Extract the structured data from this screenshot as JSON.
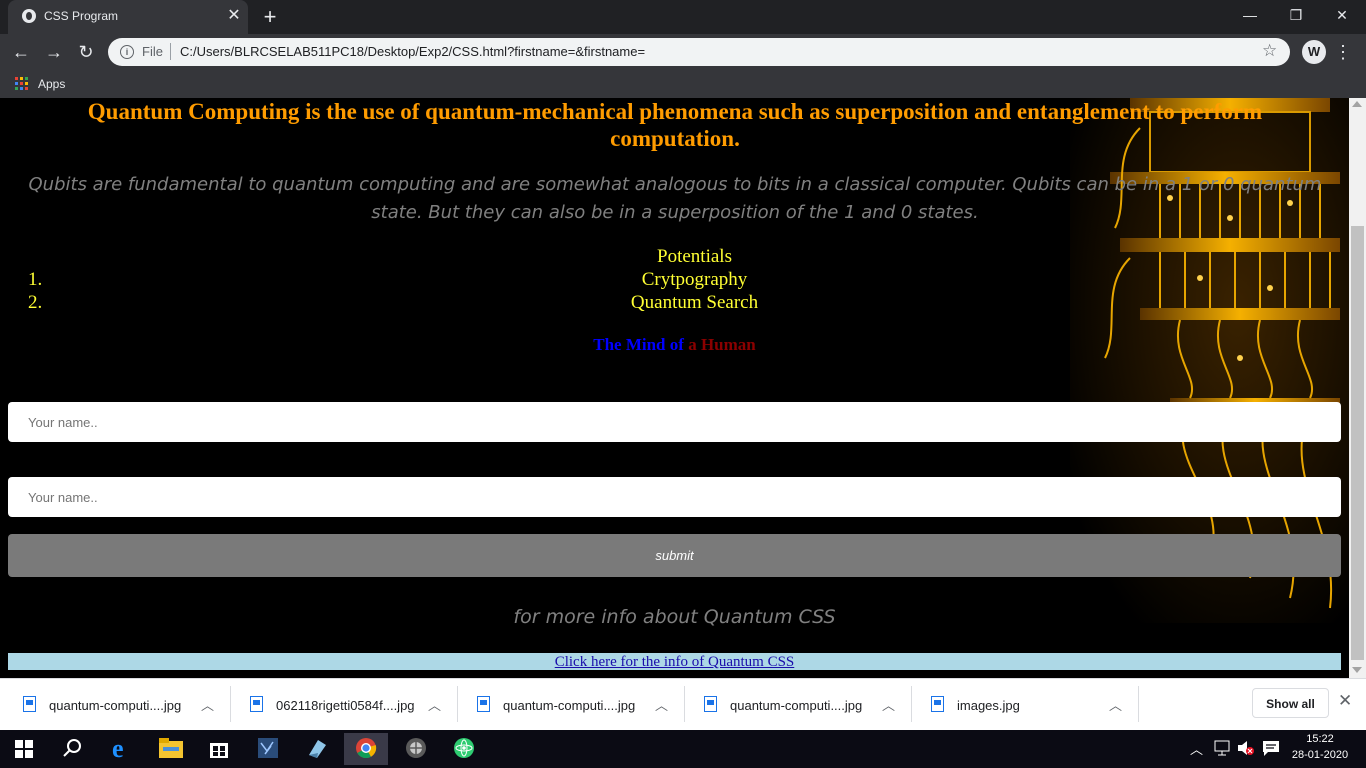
{
  "browser": {
    "tab_title": "CSS Program",
    "tab_close": "✕",
    "new_tab": "+",
    "url_scheme": "File",
    "url": "C:/Users/BLRCSELAB511PC18/Desktop/Exp2/CSS.html?firstname=&firstname=",
    "bookmark_apps": "Apps",
    "window_controls": [
      "—",
      "❐",
      "✕"
    ]
  },
  "page": {
    "heading": "Quantum Computing is the use of quantum-mechanical phenomena such as superposition and entanglement to perform computation.",
    "paragraph": "Qubits are fundamental to quantum computing and are somewhat analogous to bits in a classical computer. Qubits can be in a 1 or 0 quantum state. But they can also be in a superposition of the 1 and 0 states.",
    "list_title": "Potentials",
    "list_items": [
      {
        "num": "1.",
        "text": "Crytpography"
      },
      {
        "num": "2.",
        "text": "Quantum Search"
      }
    ],
    "mind_part1": "The Mind of",
    "mind_part2": "a Human",
    "name_placeholder_1": "Your name..",
    "name_placeholder_2": "Your name..",
    "submit_label": "submit",
    "more_info": "for more info about Quantum CSS",
    "link_text": "Click here for the info of Quantum CSS"
  },
  "downloads": {
    "items": [
      {
        "name": "quantum-computi....jpg"
      },
      {
        "name": "062118rigetti0584f....jpg"
      },
      {
        "name": "quantum-computi....jpg"
      },
      {
        "name": "quantum-computi....jpg"
      },
      {
        "name": "images.jpg"
      }
    ],
    "show_all": "Show all",
    "close": "✕"
  },
  "taskbar": {
    "time": "15:22",
    "date": "28-01-2020"
  },
  "colors": {
    "heading": "#ff9c00",
    "paragraph": "#808080",
    "list": "#ffff33",
    "mind_blue": "#0000ff",
    "mind_red": "#8b0000",
    "submit_bg": "#7a7a7a",
    "link_bar": "#add8e6"
  }
}
